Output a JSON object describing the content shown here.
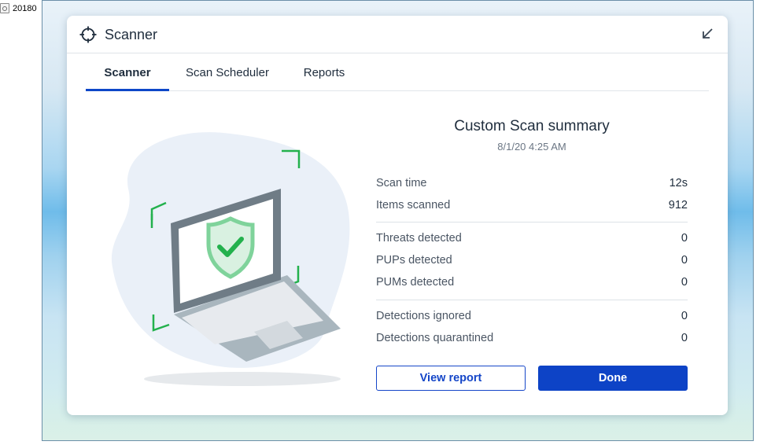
{
  "desktop": {
    "file_label": "20180"
  },
  "dialog": {
    "title": "Scanner",
    "tabs": [
      {
        "label": "Scanner",
        "active": true
      },
      {
        "label": "Scan Scheduler",
        "active": false
      },
      {
        "label": "Reports",
        "active": false
      }
    ]
  },
  "summary": {
    "title": "Custom Scan summary",
    "date": "8/1/20 4:25 AM",
    "stats": [
      {
        "label": "Scan time",
        "value": "12s"
      },
      {
        "label": "Items scanned",
        "value": "912"
      },
      {
        "label": "Threats detected",
        "value": "0"
      },
      {
        "label": "PUPs detected",
        "value": "0"
      },
      {
        "label": "PUMs detected",
        "value": "0"
      },
      {
        "label": "Detections ignored",
        "value": "0"
      },
      {
        "label": "Detections quarantined",
        "value": "0"
      }
    ]
  },
  "buttons": {
    "view_report": "View report",
    "done": "Done"
  },
  "colors": {
    "accent": "#0d43c6",
    "success": "#23b14d",
    "shield": "#7fd39b"
  }
}
